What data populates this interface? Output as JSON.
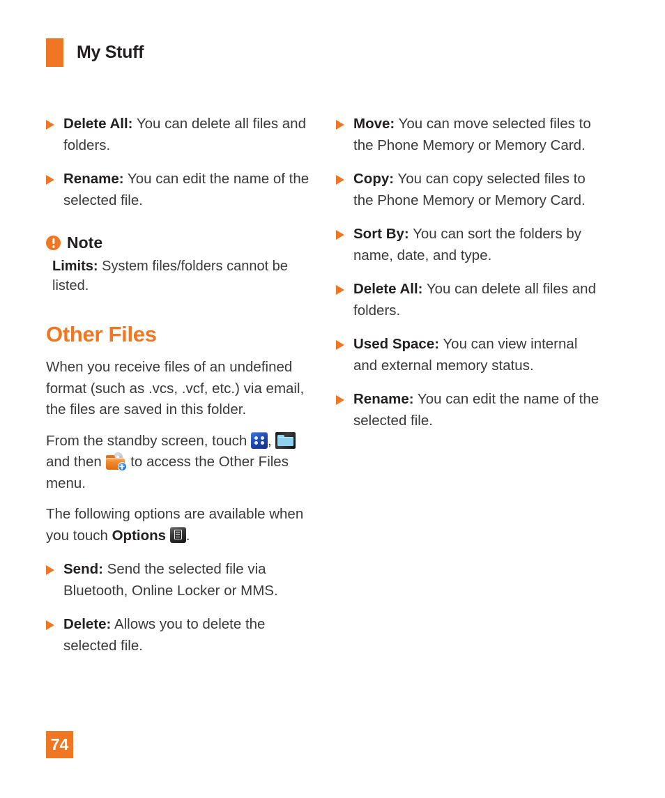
{
  "header": {
    "title": "My Stuff",
    "accent_color": "#ef7622"
  },
  "left_column": {
    "top_bullets": [
      {
        "term": "Delete All:",
        "desc": "You can delete all files and folders."
      },
      {
        "term": "Rename:",
        "desc": "You can edit the name of the selected file."
      }
    ],
    "note": {
      "icon": "exclamation-circle-icon",
      "label": "Note",
      "body_term": "Limits:",
      "body_text": "System files/folders cannot be listed."
    },
    "section": {
      "title": "Other Files",
      "paragraph_1": "When you receive files of an undefined format (such as .vcs, .vcf, etc.) via email, the files are saved in this folder.",
      "paragraph_2_part_1": "From the standby screen, touch",
      "paragraph_2_comma": ",",
      "paragraph_2_part_2": "and then",
      "paragraph_2_part_3": "to access the Other Files menu.",
      "paragraph_3_part_1": "The following options are available when you touch",
      "paragraph_3_options_label": "Options",
      "paragraph_3_part_2": "."
    },
    "option_bullets": [
      {
        "term": "Send:",
        "desc": "Send the selected file via Bluetooth, Online Locker or MMS."
      },
      {
        "term": "Delete:",
        "desc": "Allows you to delete the selected file."
      }
    ]
  },
  "right_column": {
    "bullets": [
      {
        "term": "Move:",
        "desc": "You can move selected files to the Phone Memory or Memory Card."
      },
      {
        "term": "Copy:",
        "desc": "You can copy selected files to the Phone Memory or Memory Card."
      },
      {
        "term": "Sort By:",
        "desc": "You can sort the folders by name, date, and type."
      },
      {
        "term": "Delete All:",
        "desc": "You can delete all files and folders."
      },
      {
        "term": "Used Space:",
        "desc": "You can view internal and external memory status."
      },
      {
        "term": "Rename:",
        "desc": "You can edit the name of the selected file."
      }
    ]
  },
  "footer": {
    "page_number": "74"
  }
}
